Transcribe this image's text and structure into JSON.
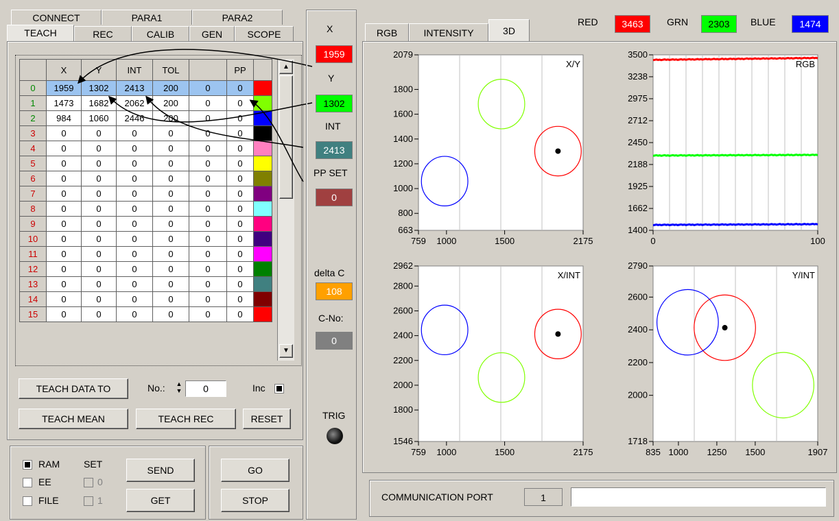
{
  "tabs_row1": [
    "CONNECT",
    "PARA1",
    "PARA2"
  ],
  "tabs_row2": [
    "TEACH",
    "REC",
    "CALIB",
    "GEN",
    "SCOPE"
  ],
  "table": {
    "headers": [
      "X",
      "Y",
      "INT",
      "TOL",
      "",
      "PP"
    ],
    "rows": [
      [
        "0",
        "1959",
        "1302",
        "2413",
        "200",
        "0",
        "0"
      ],
      [
        "1",
        "1473",
        "1682",
        "2062",
        "200",
        "0",
        "0"
      ],
      [
        "2",
        "984",
        "1060",
        "2446",
        "200",
        "0",
        "0"
      ],
      [
        "3",
        "0",
        "0",
        "0",
        "0",
        "0",
        "0"
      ],
      [
        "4",
        "0",
        "0",
        "0",
        "0",
        "0",
        "0"
      ],
      [
        "5",
        "0",
        "0",
        "0",
        "0",
        "0",
        "0"
      ],
      [
        "6",
        "0",
        "0",
        "0",
        "0",
        "0",
        "0"
      ],
      [
        "7",
        "0",
        "0",
        "0",
        "0",
        "0",
        "0"
      ],
      [
        "8",
        "0",
        "0",
        "0",
        "0",
        "0",
        "0"
      ],
      [
        "9",
        "0",
        "0",
        "0",
        "0",
        "0",
        "0"
      ],
      [
        "10",
        "0",
        "0",
        "0",
        "0",
        "0",
        "0"
      ],
      [
        "11",
        "0",
        "0",
        "0",
        "0",
        "0",
        "0"
      ],
      [
        "12",
        "0",
        "0",
        "0",
        "0",
        "0",
        "0"
      ],
      [
        "13",
        "0",
        "0",
        "0",
        "0",
        "0",
        "0"
      ],
      [
        "14",
        "0",
        "0",
        "0",
        "0",
        "0",
        "0"
      ],
      [
        "15",
        "0",
        "0",
        "0",
        "0",
        "0",
        "0"
      ]
    ],
    "row_colors": [
      "#ff0000",
      "#80ff00",
      "#0000ff",
      "#000000",
      "#ff80c0",
      "#ffff00",
      "#808000",
      "#800080",
      "#80ffff",
      "#ff0080",
      "#400080",
      "#ff00ff",
      "#008000",
      "#408080",
      "#800000",
      "#ff0000"
    ]
  },
  "buttons": {
    "teach_data_to": "TEACH DATA TO",
    "no_label": "No.:",
    "no_value": "0",
    "inc_label": "Inc",
    "teach_mean": "TEACH MEAN",
    "teach_rec": "TEACH REC",
    "reset": "RESET",
    "send": "SEND",
    "get": "GET",
    "go": "GO",
    "stop": "STOP"
  },
  "memory": {
    "ram": "RAM",
    "ee": "EE",
    "file": "FILE",
    "set": "SET",
    "set0": "0",
    "set1": "1"
  },
  "readouts": {
    "x_label": "X",
    "x_value": "1959",
    "y_label": "Y",
    "y_value": "1302",
    "int_label": "INT",
    "int_value": "2413",
    "ppset_label": "PP SET",
    "ppset_value": "0",
    "deltac_label": "delta C",
    "deltac_value": "108",
    "cno_label": "C-No:",
    "cno_value": "0",
    "trig_label": "TRIG"
  },
  "graph_tabs": [
    "RGB",
    "INTENSITY",
    "3D"
  ],
  "rgb": {
    "red_label": "RED",
    "red_value": "3463",
    "grn_label": "GRN",
    "grn_value": "2303",
    "blue_label": "BLUE",
    "blue_value": "1474"
  },
  "comm": {
    "label": "COMMUNICATION PORT",
    "port": "1"
  },
  "colors": {
    "red": "#ff0000",
    "green": "#00ff00",
    "blue": "#0000ff",
    "pp": "#a04040",
    "int": "#408080",
    "delta": "#ffa000",
    "cno": "#808080"
  },
  "chart_data": [
    {
      "type": "scatter",
      "title": "X/Y",
      "xlim": [
        759,
        2175
      ],
      "ylim": [
        663,
        2079
      ],
      "xticks": [
        "759",
        "1000",
        "1500",
        "2175"
      ],
      "yticks": [
        "2079",
        "1800",
        "1600",
        "1400",
        "1200",
        "1000",
        "800",
        "663"
      ],
      "circles": [
        {
          "x": 1959,
          "y": 1302,
          "r": 200,
          "color": "#ff0000"
        },
        {
          "x": 1473,
          "y": 1682,
          "r": 200,
          "color": "#80ff00"
        },
        {
          "x": 984,
          "y": 1060,
          "r": 200,
          "color": "#0000ff"
        }
      ],
      "point": {
        "x": 1959,
        "y": 1302
      }
    },
    {
      "type": "line",
      "title": "RGB",
      "xlim": [
        0,
        100
      ],
      "ylim": [
        1400,
        3500
      ],
      "xticks": [
        "0",
        "100"
      ],
      "yticks": [
        "3500",
        "3238",
        "2975",
        "2712",
        "2450",
        "2188",
        "1925",
        "1662",
        "1400"
      ],
      "series": [
        {
          "name": "RED",
          "value_start": 3440,
          "value_end": 3463,
          "color": "#ff0000"
        },
        {
          "name": "GRN",
          "value_start": 2295,
          "value_end": 2303,
          "color": "#00ff00"
        },
        {
          "name": "BLUE",
          "value_start": 1465,
          "value_end": 1474,
          "color": "#0000ff"
        }
      ]
    },
    {
      "type": "scatter",
      "title": "X/INT",
      "xlim": [
        759,
        2175
      ],
      "ylim": [
        1546,
        2962
      ],
      "xticks": [
        "759",
        "1000",
        "1500",
        "2175"
      ],
      "yticks": [
        "2962",
        "2800",
        "2600",
        "2400",
        "2200",
        "2000",
        "1800",
        "1546"
      ],
      "circles": [
        {
          "x": 1959,
          "y": 2413,
          "r": 200,
          "color": "#ff0000"
        },
        {
          "x": 1473,
          "y": 2062,
          "r": 200,
          "color": "#80ff00"
        },
        {
          "x": 984,
          "y": 2446,
          "r": 200,
          "color": "#0000ff"
        }
      ],
      "point": {
        "x": 1959,
        "y": 2413
      }
    },
    {
      "type": "scatter",
      "title": "Y/INT",
      "xlim": [
        835,
        1907
      ],
      "ylim": [
        1718,
        2790
      ],
      "xticks": [
        "835",
        "1000",
        "1250",
        "1500",
        "1907"
      ],
      "yticks": [
        "2790",
        "2600",
        "2400",
        "2200",
        "2000",
        "1718"
      ],
      "circles": [
        {
          "x": 1302,
          "y": 2413,
          "r": 200,
          "color": "#ff0000"
        },
        {
          "x": 1682,
          "y": 2062,
          "r": 200,
          "color": "#80ff00"
        },
        {
          "x": 1060,
          "y": 2446,
          "r": 200,
          "color": "#0000ff"
        }
      ],
      "point": {
        "x": 1302,
        "y": 2413
      }
    }
  ]
}
